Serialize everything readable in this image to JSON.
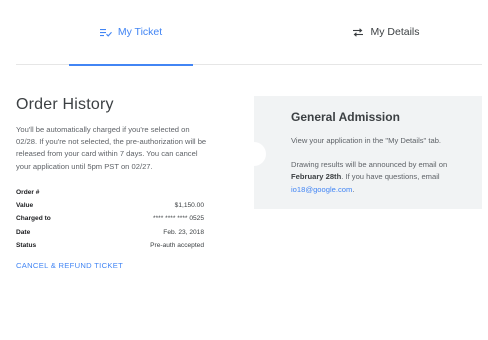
{
  "tabs": {
    "ticket": {
      "label": "My Ticket",
      "icon": "checklist-icon"
    },
    "details": {
      "label": "My Details",
      "icon": "swap-arrows-icon"
    },
    "accent": "#4285f4"
  },
  "order": {
    "title": "Order History",
    "description": "You'll be automatically charged if you're selected on 02/28. If you're not selected, the pre-authorization will be released from your card within 7 days. You can cancel your application until 5pm PST on 02/27.",
    "rows": [
      {
        "label": "Order #",
        "value": ""
      },
      {
        "label": "Value",
        "value": "$1,150.00"
      },
      {
        "label": "Charged to",
        "value": "**** **** **** 0525"
      },
      {
        "label": "Date",
        "value": "Feb. 23, 2018"
      },
      {
        "label": "Status",
        "value": "Pre-auth accepted"
      }
    ],
    "cancel_label": "CANCEL & REFUND TICKET"
  },
  "admission": {
    "title": "General Admission",
    "line1": "View your application in the \"My Details\" tab.",
    "line2_a": "Drawing results will be announced by email on ",
    "line2_date": "February 28th",
    "line2_b": ". If you have questions, email ",
    "email": "io18@google.com",
    "line2_end": "."
  }
}
